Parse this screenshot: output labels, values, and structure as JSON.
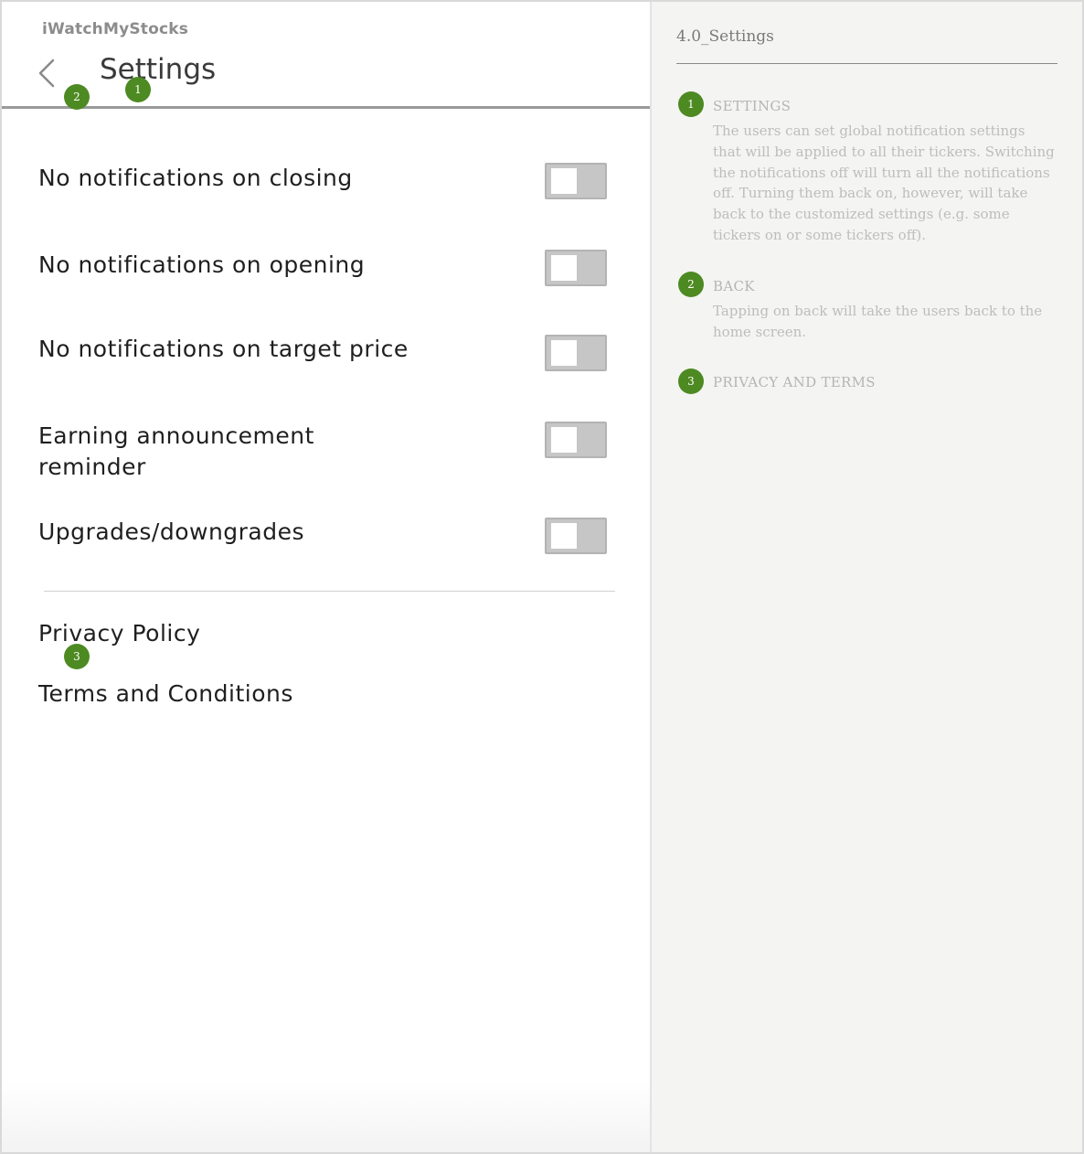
{
  "app": {
    "name": "iWatchMyStocks"
  },
  "header": {
    "title": "Settings"
  },
  "settings": [
    {
      "label": "No notifications on closing",
      "enabled": false
    },
    {
      "label": "No notifications on opening",
      "enabled": false
    },
    {
      "label": "No notifications on target price",
      "enabled": false
    },
    {
      "label": "Earning announcement reminder",
      "enabled": false
    },
    {
      "label": "Upgrades/downgrades",
      "enabled": false
    }
  ],
  "links": {
    "privacy": "Privacy Policy",
    "terms": "Terms and Conditions"
  },
  "markers": [
    "1",
    "2",
    "3"
  ],
  "notes": {
    "title": "4.0_Settings",
    "items": [
      {
        "number": "1",
        "heading": "SETTINGS",
        "body": "The users can set global notification settings that will be applied to all their tickers. Switching the notifications off will turn all the notifications off. Turning them back on, however, will take back to the customized settings (e.g. some tickers on or some tickers off)."
      },
      {
        "number": "2",
        "heading": "BACK",
        "body": "Tapping on back will take the users back to the home screen."
      },
      {
        "number": "3",
        "heading": "PRIVACY AND TERMS",
        "body": ""
      }
    ]
  },
  "colors": {
    "marker": "#4d8a22",
    "toggle_off": "#c6c6c6",
    "annotation_text": "#bdbdbd"
  }
}
